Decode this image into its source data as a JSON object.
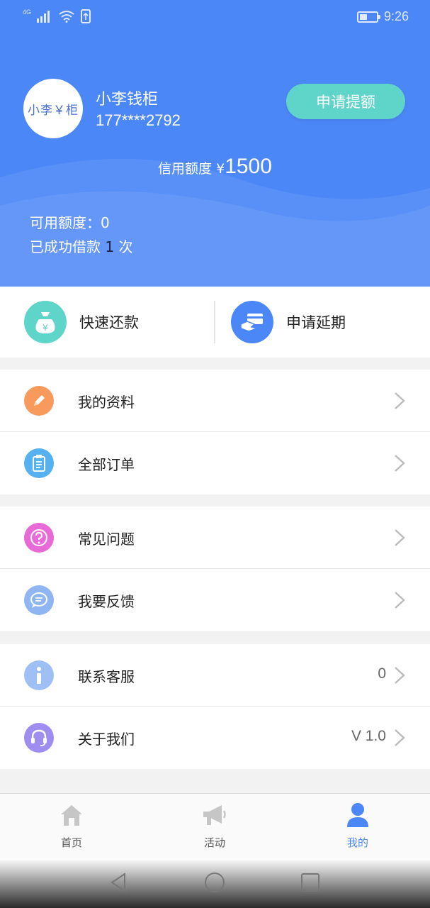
{
  "status_bar": {
    "network": "4G",
    "time": "9:26"
  },
  "profile": {
    "avatar_text": "小李￥柜",
    "name": "小李钱柜",
    "phone": "177****2792",
    "apply_button": "申请提额",
    "credit_label": "信用额度 ¥",
    "credit_amount": "1500",
    "available_label": "可用额度：0",
    "borrowed_prefix": "已成功借款",
    "borrowed_count": "1",
    "borrowed_suffix": "次"
  },
  "quick_actions": [
    {
      "label": "快速还款",
      "icon": "money-bag-icon",
      "color": "#5fd4c8"
    },
    {
      "label": "申请延期",
      "icon": "card-hand-icon",
      "color": "#4b87f7"
    }
  ],
  "menu": [
    {
      "label": "我的资料",
      "icon": "pencil-icon",
      "color": "#f79a5c",
      "value": ""
    },
    {
      "label": "全部订单",
      "icon": "clipboard-icon",
      "color": "#56b1f0",
      "value": ""
    },
    {
      "label": "常见问题",
      "icon": "question-icon",
      "color": "#e86ad7",
      "value": ""
    },
    {
      "label": "我要反馈",
      "icon": "chat-bubble-icon",
      "color": "#8fb6f2",
      "value": ""
    },
    {
      "label": "联系客服",
      "icon": "info-icon",
      "color": "#9ec0f5",
      "value": "0"
    },
    {
      "label": "关于我们",
      "icon": "headset-icon",
      "color": "#9f8ef0",
      "value": "V 1.0"
    }
  ],
  "tabs": [
    {
      "label": "首页",
      "icon": "home-icon",
      "active": false
    },
    {
      "label": "活动",
      "icon": "megaphone-icon",
      "active": false
    },
    {
      "label": "我的",
      "icon": "person-icon",
      "active": true
    }
  ],
  "colors": {
    "primary": "#4b87f7",
    "teal": "#5fd4c8"
  }
}
